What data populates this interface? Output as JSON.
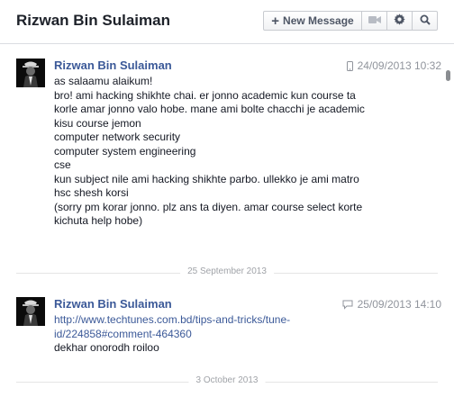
{
  "header": {
    "title": "Rizwan Bin Sulaiman",
    "new_message_label": "New Message",
    "icons": [
      "plus-icon",
      "video-camera-icon",
      "gear-icon",
      "search-icon"
    ]
  },
  "messages": [
    {
      "sender": "Rizwan Bin Sulaiman",
      "timestamp": "24/09/2013 10:32",
      "source_icon": "mobile-phone-icon",
      "lines": [
        "as salaamu alaikum!",
        "bro!  ami hacking shikhte chai. er jonno academic kun course ta",
        "korle amar jonno valo hobe. mane ami bolte chacchi je academic",
        "kisu course jemon",
        "computer network security",
        "computer system engineering",
        "cse",
        "kun subject nile ami hacking shikhte parbo. ullekko je ami matro",
        "hsc shesh korsi",
        "(sorry pm korar jonno. plz ans ta diyen. amar course select korte",
        "kichuta help hobe)"
      ]
    },
    {
      "sender": "Rizwan Bin Sulaiman",
      "timestamp": "25/09/2013 14:10",
      "source_icon": "chat-bubble-icon",
      "link_lines": [
        "http://www.techtunes.com.bd/tips-and-tricks/tune-",
        "id/224858#comment-464360"
      ],
      "lines": [
        "dekhar onorodh roiloo"
      ]
    }
  ],
  "dividers": [
    "25 September 2013",
    "3 October 2013"
  ],
  "colors": {
    "link": "#3b5998",
    "text": "#141823",
    "meta": "#90949c",
    "divider_text": "#a0a3a8"
  }
}
